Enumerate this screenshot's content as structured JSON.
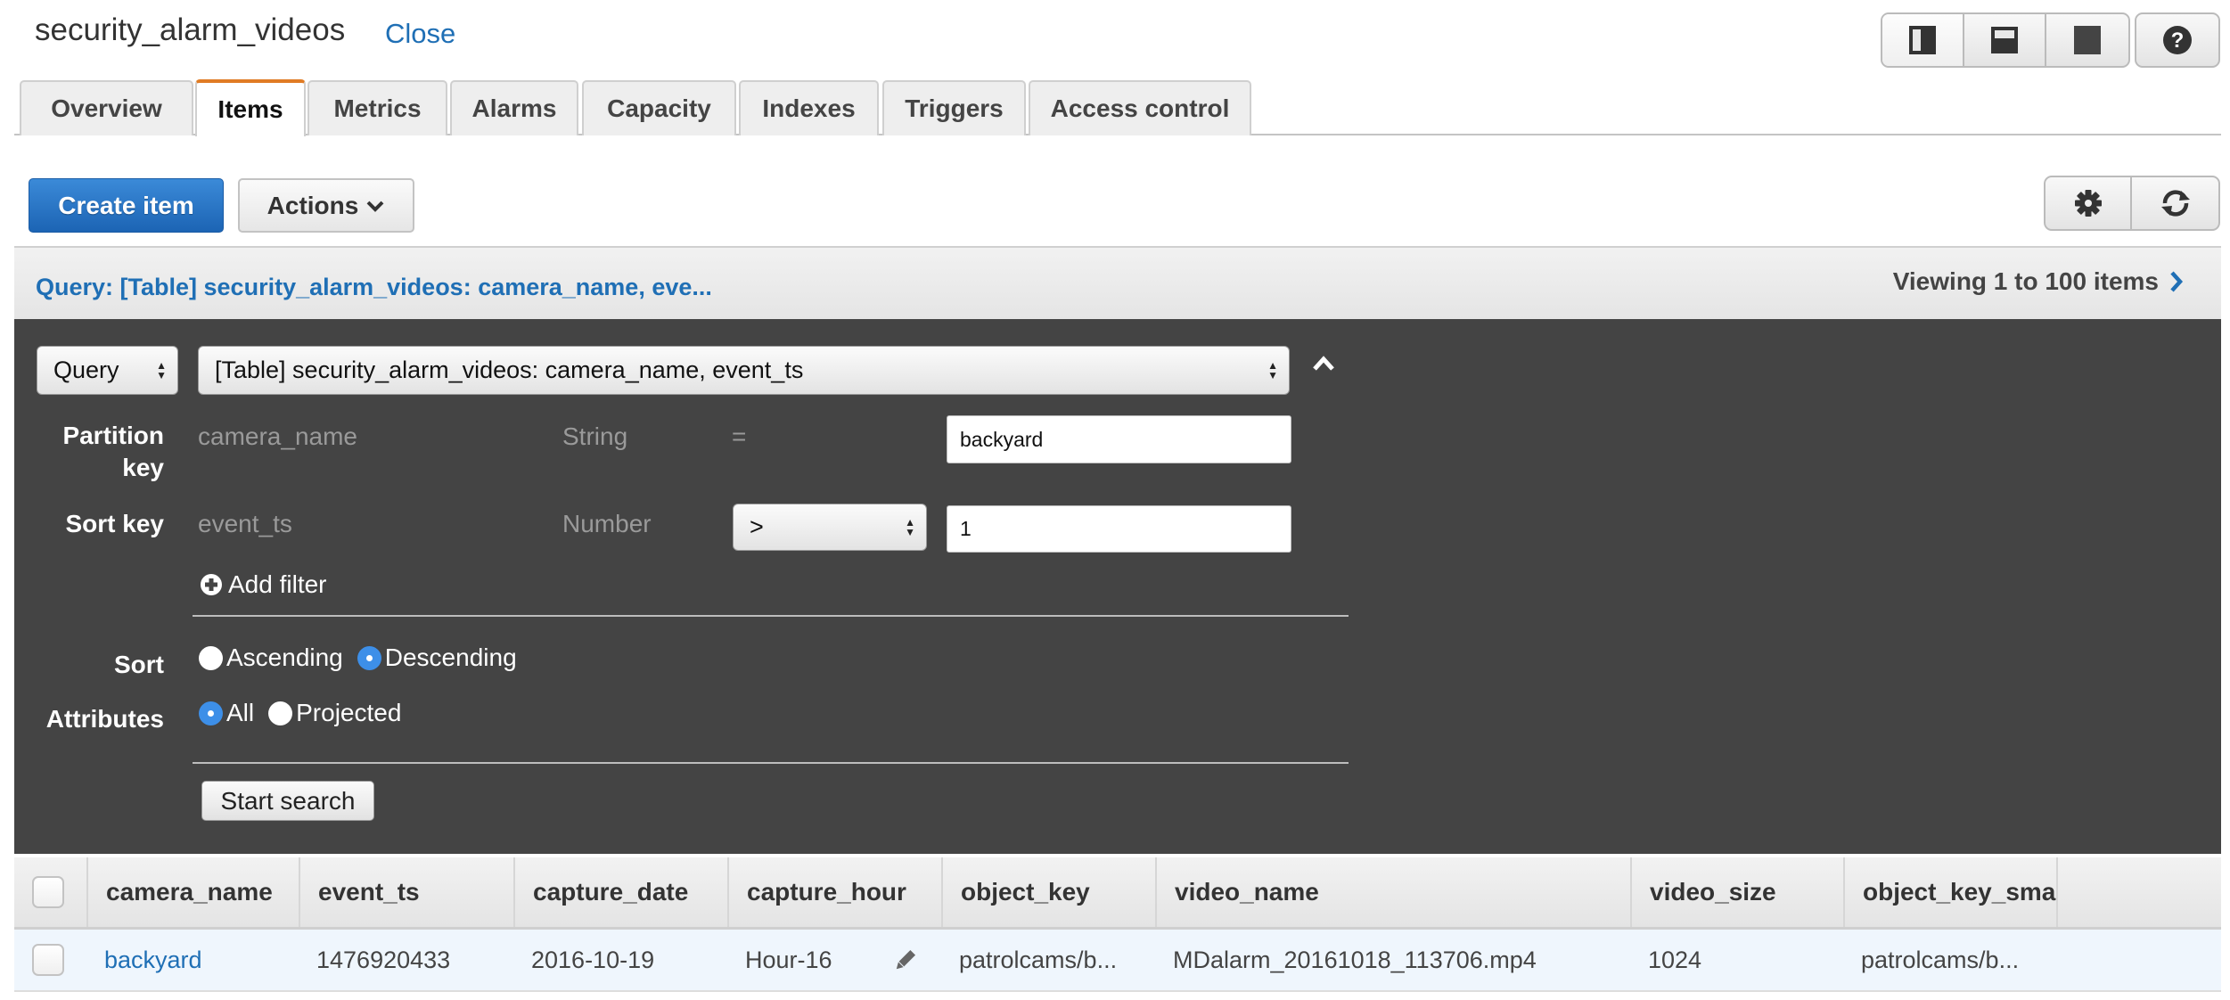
{
  "header": {
    "title": "security_alarm_videos",
    "close_label": "Close",
    "layout_buttons": [
      {
        "icon": "split-vertical-icon",
        "active": true
      },
      {
        "icon": "split-horizontal-icon",
        "active": false
      },
      {
        "icon": "full-view-icon",
        "active": false
      }
    ],
    "help_icon": "question-circle-icon"
  },
  "tabs": [
    {
      "label": "Overview",
      "active": false
    },
    {
      "label": "Items",
      "active": true
    },
    {
      "label": "Metrics",
      "active": false
    },
    {
      "label": "Alarms",
      "active": false
    },
    {
      "label": "Capacity",
      "active": false
    },
    {
      "label": "Indexes",
      "active": false
    },
    {
      "label": "Triggers",
      "active": false
    },
    {
      "label": "Access control",
      "active": false
    }
  ],
  "toolbar": {
    "create_label": "Create item",
    "actions_label": "Actions",
    "settings_icon": "gear-icon",
    "refresh_icon": "refresh-icon"
  },
  "query_bar": {
    "title": "Query: [Table] security_alarm_videos: camera_name, eve...",
    "viewing": "Viewing 1 to 100 items"
  },
  "query_panel": {
    "mode_value": "Query",
    "index_value": "[Table] security_alarm_videos: camera_name, event_ts",
    "partition_label": "Partition key",
    "partition_label_line1": "Partition",
    "partition_label_line2": "key",
    "partition_attr": "camera_name",
    "partition_type": "String",
    "partition_op": "=",
    "partition_value": "backyard",
    "sort_key_label": "Sort key",
    "sort_attr": "event_ts",
    "sort_type": "Number",
    "sort_op_value": ">",
    "sort_value": "1",
    "add_filter_label": "Add filter",
    "sort_label": "Sort",
    "sort_options": [
      {
        "label": "Ascending",
        "selected": false
      },
      {
        "label": "Descending",
        "selected": true
      }
    ],
    "attributes_label": "Attributes",
    "attribute_options": [
      {
        "label": "All",
        "selected": true
      },
      {
        "label": "Projected",
        "selected": false
      }
    ],
    "start_search_label": "Start search"
  },
  "table": {
    "columns": [
      "camera_name",
      "event_ts",
      "capture_date",
      "capture_hour",
      "object_key",
      "video_name",
      "video_size",
      "object_key_smal"
    ],
    "rows": [
      {
        "camera_name": "backyard",
        "event_ts": "1476920433",
        "capture_date": "2016-10-19",
        "capture_hour": "Hour-16",
        "object_key": "patrolcams/b...",
        "video_name": "MDalarm_20161018_113706.mp4",
        "video_size": "1024",
        "object_key_small": "patrolcams/b..."
      }
    ]
  },
  "colors": {
    "accent_blue": "#1f6fb5",
    "primary_button": "#1c64b4",
    "active_tab": "#e07b24",
    "panel_bg": "#444444",
    "radio_selected": "#3d8fe8",
    "row_highlight": "#eff6fd"
  }
}
